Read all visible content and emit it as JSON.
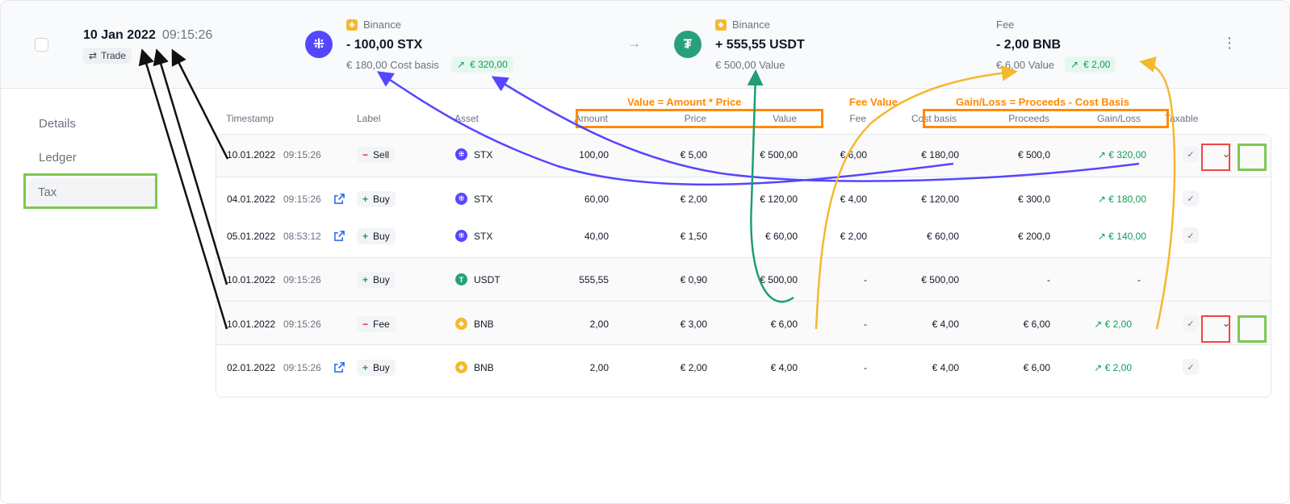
{
  "header": {
    "date": "10 Jan 2022",
    "time": "09:15:26",
    "trade_badge": "Trade",
    "sent": {
      "exchange": "Binance",
      "amount": "- 100,00 STX",
      "cost_basis": "€ 180,00 Cost basis",
      "gain": "€ 320,00",
      "coin_icon": "stx-icon"
    },
    "arrow": "→",
    "received": {
      "exchange": "Binance",
      "amount": "+ 555,55 USDT",
      "value": "€ 500,00 Value",
      "coin_icon": "usdt-icon"
    },
    "fee": {
      "label": "Fee",
      "amount": "- 2,00 BNB",
      "value": "€ 6,00 Value",
      "gain": "€ 2,00"
    }
  },
  "sidebar": {
    "items": [
      {
        "label": "Details"
      },
      {
        "label": "Ledger"
      },
      {
        "label": "Tax"
      }
    ]
  },
  "table": {
    "headers": {
      "timestamp": "Timestamp",
      "label": "Label",
      "asset": "Asset",
      "amount": "Amount",
      "price": "Price",
      "value": "Value",
      "fee": "Fee",
      "cost_basis": "Cost basis",
      "proceeds": "Proceeds",
      "gain_loss": "Gain/Loss",
      "taxable": "Taxable"
    },
    "rows": [
      {
        "date": "10.01.2022",
        "time": "09:15:26",
        "label": "Sell",
        "sign": "−",
        "asset": "STX",
        "amount": "100,00",
        "price": "€ 5,00",
        "value": "€ 500,00",
        "fee": "€ 6,00",
        "cost_basis": "€ 180,00",
        "proceeds": "€ 500,0",
        "gain": "€ 320,00",
        "gain_arrow": "↗"
      },
      {
        "date": "04.01.2022",
        "time": "09:15:26",
        "label": "Buy",
        "sign": "+",
        "asset": "STX",
        "amount": "60,00",
        "price": "€ 2,00",
        "value": "€ 120,00",
        "fee": "€ 4,00",
        "cost_basis": "€ 120,00",
        "proceeds": "€ 300,0",
        "gain": "€ 180,00",
        "gain_arrow": "↗"
      },
      {
        "date": "05.01.2022",
        "time": "08:53:12",
        "label": "Buy",
        "sign": "+",
        "asset": "STX",
        "amount": "40,00",
        "price": "€ 1,50",
        "value": "€ 60,00",
        "fee": "€ 2,00",
        "cost_basis": "€ 60,00",
        "proceeds": "€ 200,0",
        "gain": "€ 140,00",
        "gain_arrow": "↗"
      },
      {
        "date": "10.01.2022",
        "time": "09:15:26",
        "label": "Buy",
        "sign": "+",
        "asset": "USDT",
        "amount": "555,55",
        "price": "€ 0,90",
        "value": "€ 500,00",
        "fee": "-",
        "cost_basis": "€ 500,00",
        "proceeds": "-",
        "gain": "-",
        "gain_arrow": ""
      },
      {
        "date": "10.01.2022",
        "time": "09:15:26",
        "label": "Fee",
        "sign": "−",
        "asset": "BNB",
        "amount": "2,00",
        "price": "€ 3,00",
        "value": "€ 6,00",
        "fee": "-",
        "cost_basis": "€ 4,00",
        "proceeds": "€ 6,00",
        "gain": "€ 2,00",
        "gain_arrow": "↗"
      },
      {
        "date": "02.01.2022",
        "time": "09:15:26",
        "label": "Buy",
        "sign": "+",
        "asset": "BNB",
        "amount": "2,00",
        "price": "€ 2,00",
        "value": "€ 4,00",
        "fee": "-",
        "cost_basis": "€ 4,00",
        "proceeds": "€ 6,00",
        "gain": "€ 2,00",
        "gain_arrow": "↗"
      }
    ],
    "taxable_check": "✓",
    "chevron": "⌄"
  },
  "annotations": {
    "value_formula": "Value = Amount * Price",
    "fee_value": "Fee Value",
    "gain_formula": "Gain/Loss = Proceeds - Cost Basis"
  },
  "colors": {
    "stx": "#5546ff",
    "usdt": "#26a17b",
    "bnb": "#f3ba2f",
    "gain": "#0f9d58",
    "annotation_orange": "#ff8a00",
    "annotation_green": "#7ec850",
    "annotation_red": "#ef4444",
    "arrow_blue": "#5546ff",
    "arrow_teal": "#1f9d74",
    "arrow_yellow": "#f5b82e"
  }
}
